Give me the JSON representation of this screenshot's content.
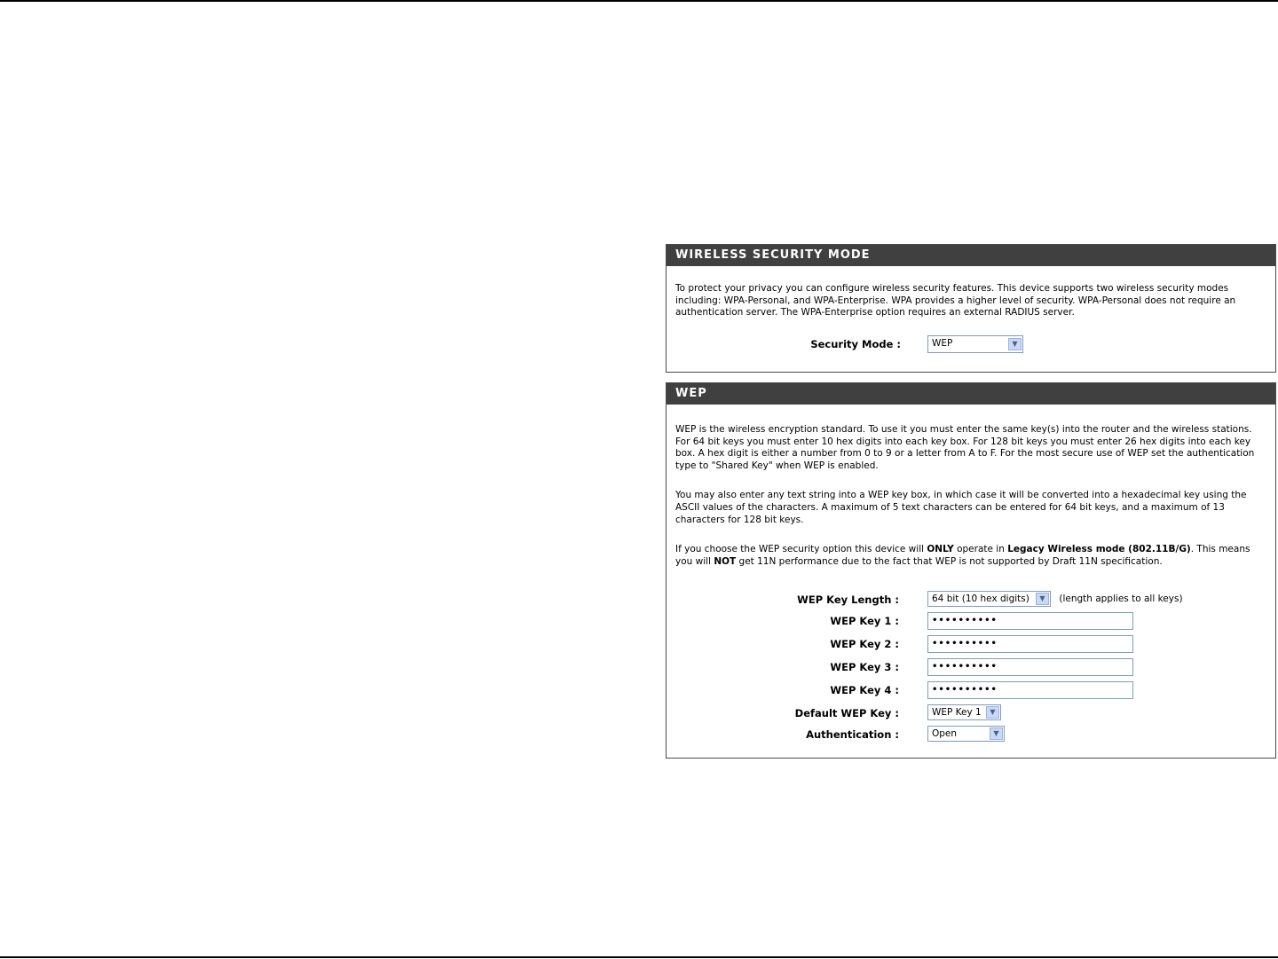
{
  "security_panel": {
    "title": "WIRELESS SECURITY MODE",
    "description": "To protect your privacy you can configure wireless security features. This device supports two wireless security modes including: WPA-Personal, and WPA-Enterprise. WPA provides a higher level of security. WPA-Personal does not require an authentication server. The WPA-Enterprise option requires an external RADIUS server.",
    "mode_label": "Security Mode :",
    "mode_value": "WEP"
  },
  "wep_panel": {
    "title": "WEP",
    "para1": "WEP is the wireless encryption standard. To use it you must enter the same key(s) into the router and the wireless stations. For 64 bit keys you must enter 10 hex digits into each key box. For 128 bit keys you must enter 26 hex digits into each key box. A hex digit is either a number from 0 to 9 or a letter from A to F. For the most secure use of WEP set the authentication type to \"Shared Key\" when WEP is enabled.",
    "para2": "You may also enter any text string into a WEP key box, in which case it will be converted into a hexadecimal key using the ASCII values of the characters. A maximum of 5 text characters can be entered for 64 bit keys, and a maximum of 13 characters for 128 bit keys.",
    "para3_a": "If you choose the WEP security option this device will ",
    "para3_b": "ONLY",
    "para3_c": " operate in ",
    "para3_d": "Legacy Wireless mode (802.11B/G)",
    "para3_e": ". This means you will ",
    "para3_f": "NOT",
    "para3_g": " get 11N performance due to the fact that WEP is not supported by Draft 11N specification.",
    "key_length_label": "WEP Key Length :",
    "key_length_value": "64 bit (10 hex digits)",
    "key_length_hint": "(length applies to all keys)",
    "keys": [
      {
        "label": "WEP Key 1 :",
        "value": "••••••••••"
      },
      {
        "label": "WEP Key 2 :",
        "value": "••••••••••"
      },
      {
        "label": "WEP Key 3 :",
        "value": "••••••••••"
      },
      {
        "label": "WEP Key 4 :",
        "value": "••••••••••"
      }
    ],
    "default_key_label": "Default WEP Key :",
    "default_key_value": "WEP Key 1",
    "auth_label": "Authentication :",
    "auth_value": "Open"
  },
  "icons": {
    "dropdown": "chevron-down-icon"
  }
}
